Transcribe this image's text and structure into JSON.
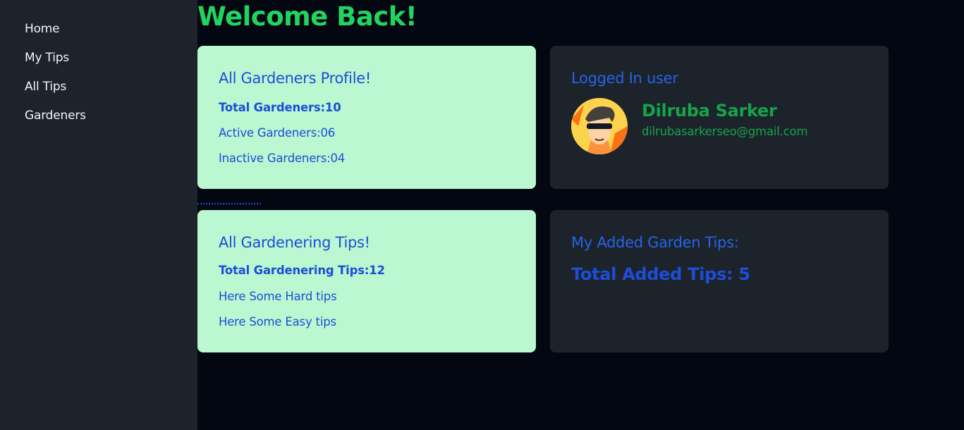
{
  "sidebar": {
    "items": [
      {
        "label": "Home"
      },
      {
        "label": "My Tips"
      },
      {
        "label": "All Tips"
      },
      {
        "label": "Gardeners"
      }
    ]
  },
  "main": {
    "title": "Welcome Back!",
    "gardeners_card": {
      "title": "All Gardeners Profile!",
      "total": "Total Gardeners:10",
      "active": "Active Gardeners:06",
      "inactive": "Inactive Gardeners:04"
    },
    "user_card": {
      "title": "Logged In user",
      "name": "Dilruba Sarker",
      "email": "dilrubasarkerseo@gmail.com",
      "avatar_icon": "cartoon-avatar-icon"
    },
    "tips_card": {
      "title": "All Gardenering Tips!",
      "total": "Total Gardenering Tips:12",
      "hard": "Here Some Hard tips",
      "easy": "Here Some Easy tips"
    },
    "my_tips_card": {
      "title": "My Added Garden Tips:",
      "total": "Total Added Tips: 5"
    }
  },
  "colors": {
    "accent_green": "#22d35f",
    "card_green": "#bbf7d0",
    "text_blue": "#1d4ed8",
    "sidebar_bg": "#1d232a",
    "page_bg": "#030712"
  }
}
